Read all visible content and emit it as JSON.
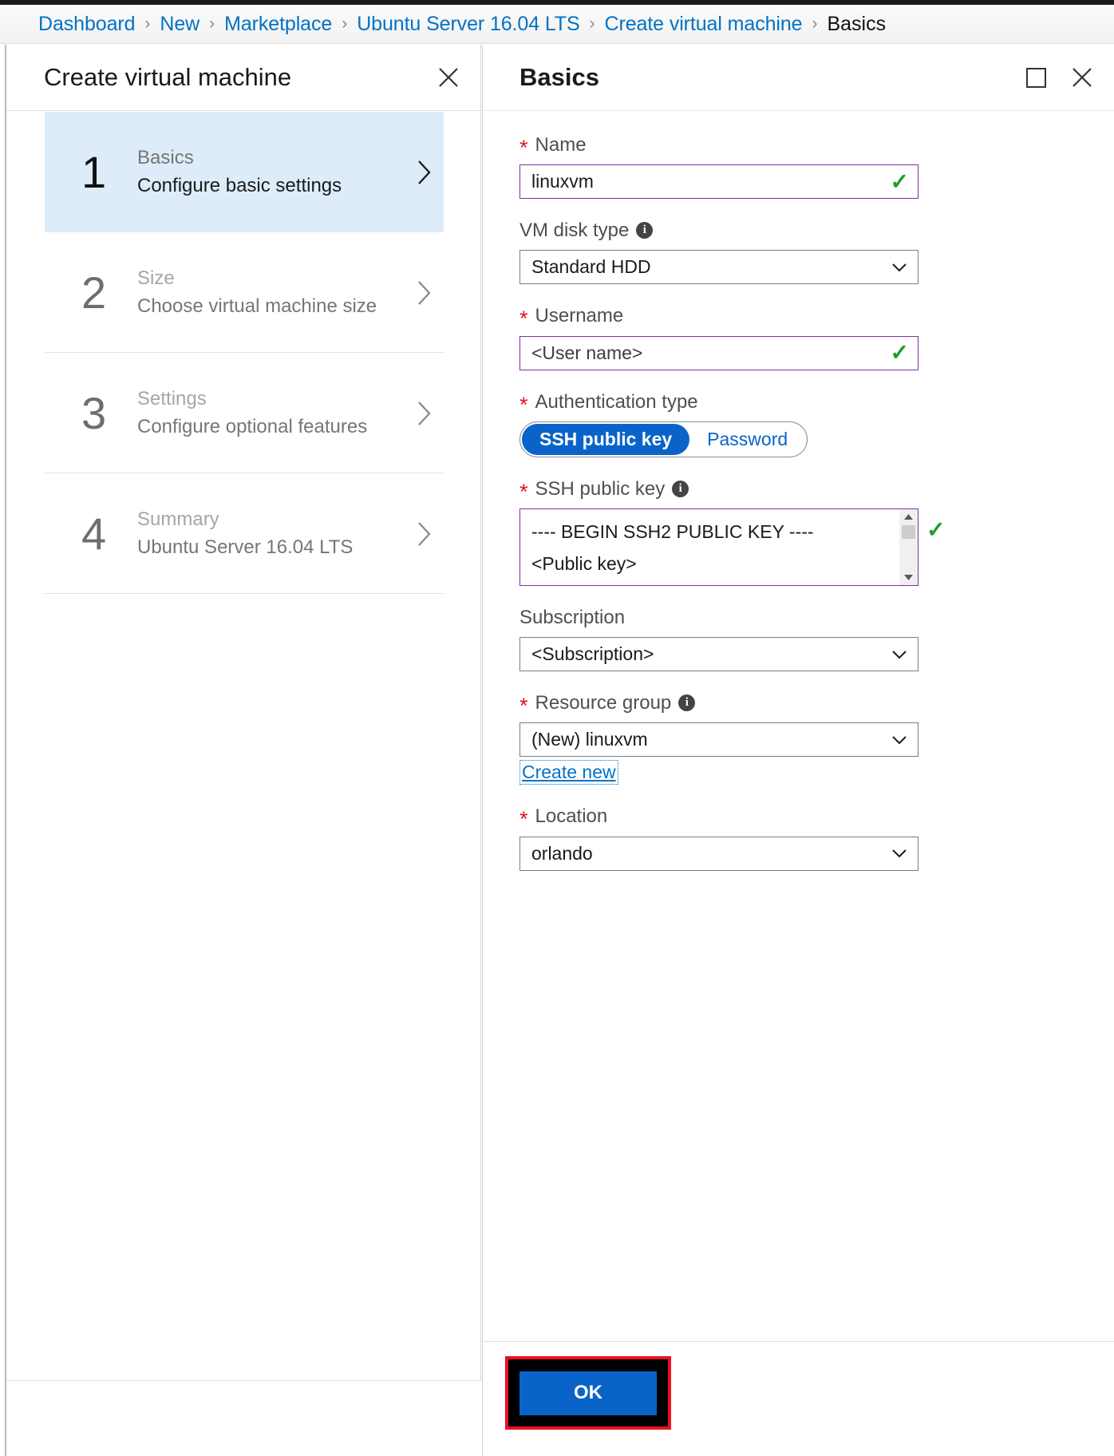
{
  "breadcrumb": {
    "items": [
      {
        "label": "Dashboard",
        "current": false
      },
      {
        "label": "New",
        "current": false
      },
      {
        "label": "Marketplace",
        "current": false
      },
      {
        "label": "Ubuntu Server 16.04 LTS",
        "current": false
      },
      {
        "label": "Create virtual machine",
        "current": false
      },
      {
        "label": "Basics",
        "current": true
      }
    ],
    "separator": "›"
  },
  "left_blade": {
    "title": "Create virtual machine",
    "close_icon": "close-icon",
    "steps": [
      {
        "number": "1",
        "title": "Basics",
        "subtitle": "Configure basic settings",
        "state": "active"
      },
      {
        "number": "2",
        "title": "Size",
        "subtitle": "Choose virtual machine size",
        "state": "dim"
      },
      {
        "number": "3",
        "title": "Settings",
        "subtitle": "Configure optional features",
        "state": "dim"
      },
      {
        "number": "4",
        "title": "Summary",
        "subtitle": "Ubuntu Server 16.04 LTS",
        "state": "dim"
      }
    ]
  },
  "right_blade": {
    "title": "Basics",
    "maximize_icon": "maximize-icon",
    "close_icon": "close-icon",
    "form": {
      "name": {
        "label": "Name",
        "required": true,
        "value": "linuxvm",
        "valid_mark": "✓"
      },
      "vm_disk_type": {
        "label": "VM disk type",
        "required": false,
        "has_info": true,
        "value": "Standard HDD"
      },
      "username": {
        "label": "Username",
        "required": true,
        "value": "<User name>",
        "valid_mark": "✓"
      },
      "authentication_type": {
        "label": "Authentication type",
        "required": true,
        "options": [
          "SSH public key",
          "Password"
        ],
        "selected": "SSH public key"
      },
      "ssh_public_key": {
        "label": "SSH public key",
        "required": true,
        "has_info": true,
        "lines": [
          "---- BEGIN SSH2 PUBLIC KEY ----",
          "<Public key>"
        ],
        "valid_mark": "✓",
        "scroll_up": "▲",
        "scroll_down": "▼"
      },
      "subscription": {
        "label": "Subscription",
        "required": false,
        "value": "<Subscription>"
      },
      "resource_group": {
        "label": "Resource group",
        "required": true,
        "has_info": true,
        "value": "(New) linuxvm",
        "create_new_link": "Create new"
      },
      "location": {
        "label": "Location",
        "required": true,
        "value": "orlando"
      }
    },
    "footer": {
      "ok_label": "OK"
    }
  },
  "colors": {
    "link_blue": "#0072c6",
    "accent_blue": "#0a63c9",
    "required_border": "#7d2fa0",
    "required_star": "#e81123",
    "valid_green": "#1f9c2e",
    "active_step_bg": "#deecf9",
    "highlight_red": "#e81123"
  }
}
